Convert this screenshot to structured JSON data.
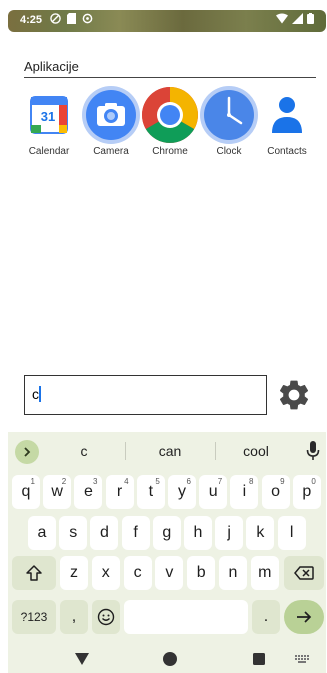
{
  "status_bar": {
    "time": "4:25",
    "left_icons": [
      "do-not-disturb-icon",
      "sim-icon",
      "sync-icon"
    ],
    "right_icons": [
      "wifi-icon",
      "signal-icon",
      "battery-icon"
    ]
  },
  "section": {
    "title": "Aplikacije"
  },
  "apps": [
    {
      "name": "Calendar",
      "icon": "calendar-icon",
      "icon_text": "31"
    },
    {
      "name": "Camera",
      "icon": "camera-icon"
    },
    {
      "name": "Chrome",
      "icon": "chrome-icon"
    },
    {
      "name": "Clock",
      "icon": "clock-icon"
    },
    {
      "name": "Contacts",
      "icon": "contacts-icon"
    }
  ],
  "search": {
    "value": "c"
  },
  "keyboard": {
    "suggestions": [
      "c",
      "can",
      "cool"
    ],
    "row1": [
      {
        "k": "q",
        "h": "1"
      },
      {
        "k": "w",
        "h": "2"
      },
      {
        "k": "e",
        "h": "3"
      },
      {
        "k": "r",
        "h": "4"
      },
      {
        "k": "t",
        "h": "5"
      },
      {
        "k": "y",
        "h": "6"
      },
      {
        "k": "u",
        "h": "7"
      },
      {
        "k": "i",
        "h": "8"
      },
      {
        "k": "o",
        "h": "9"
      },
      {
        "k": "p",
        "h": "0"
      }
    ],
    "row2": [
      "a",
      "s",
      "d",
      "f",
      "g",
      "h",
      "j",
      "k",
      "l"
    ],
    "row3": [
      "z",
      "x",
      "c",
      "v",
      "b",
      "n",
      "m"
    ],
    "symbols_label": "?123",
    "comma_label": ",",
    "period_label": ".",
    "colors": {
      "accent": "#b9d196",
      "surface": "#eef2e4"
    }
  }
}
